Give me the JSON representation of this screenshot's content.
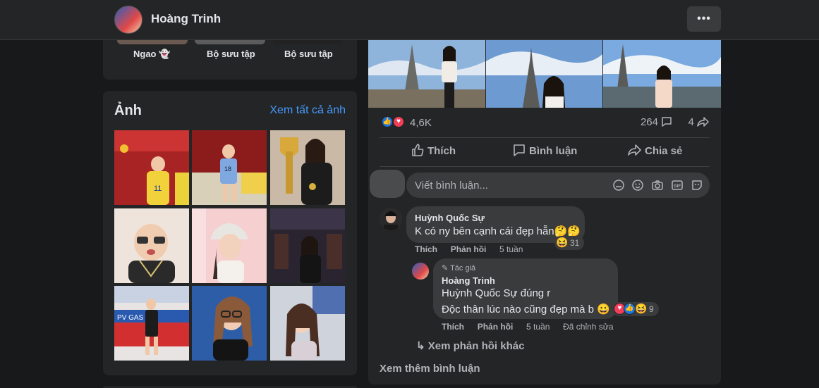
{
  "header": {
    "name": "Hoàng Trinh",
    "more_label": "•••"
  },
  "highlights": [
    "Ngao 👻",
    "Bộ sưu tập",
    "Bộ sưu tập"
  ],
  "photos": {
    "title": "Ảnh",
    "see_all": "Xem tất cả ảnh"
  },
  "post": {
    "reaction_count": "4,6K",
    "comment_count": "264",
    "share_count": "4",
    "actions": {
      "like": "Thích",
      "comment": "Bình luận",
      "share": "Chia sẻ"
    },
    "comment_placeholder": "Viết bình luận..."
  },
  "comments": [
    {
      "author": "Huỳnh Quốc Sự",
      "text": "K có ny bên cạnh cái đẹp hẵn🤔🤔",
      "like": "Thích",
      "reply": "Phản hồi",
      "time": "5 tuần",
      "reaction_count": "31"
    }
  ],
  "reply": {
    "badge": "Tác giả",
    "author": "Hoàng Trinh",
    "line1": "Huỳnh Quốc Sự đúng r",
    "line2": "Độc thân lúc nào cũng đẹp mà b 😀",
    "like": "Thích",
    "reply": "Phản hồi",
    "time": "5 tuần",
    "edited": "Đã chỉnh sửa",
    "reaction_count": "9"
  },
  "more_replies": "Xem phản hồi khác",
  "see_more_comments": "Xem thêm bình luận"
}
